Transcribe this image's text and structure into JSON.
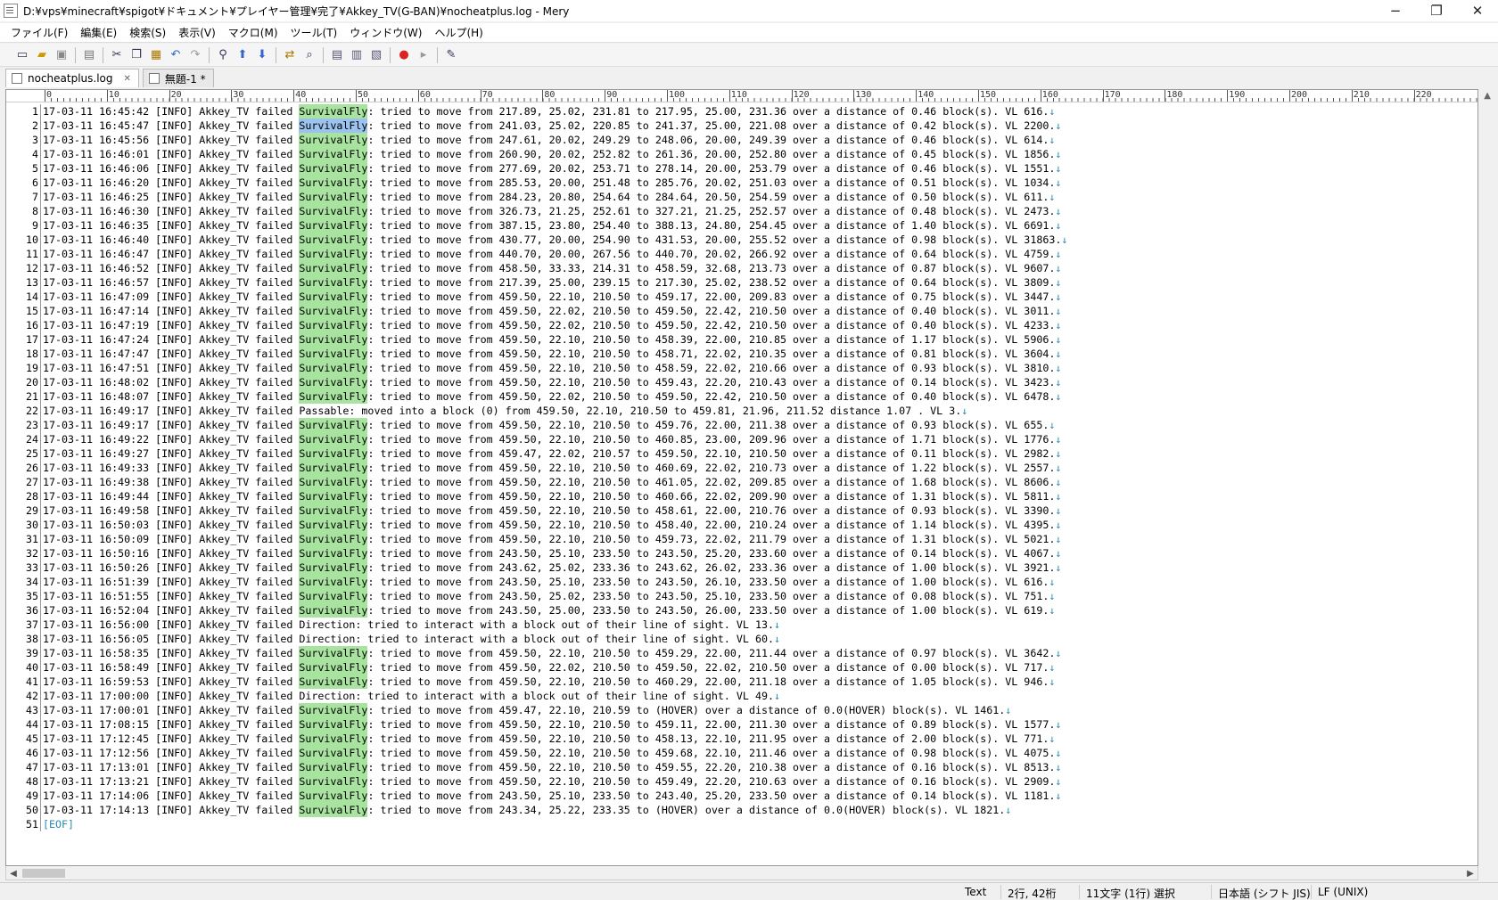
{
  "window": {
    "title": "D:¥vps¥minecraft¥spigot¥ドキュメント¥プレイヤー管理¥完了¥Akkey_TV(G-BAN)¥nocheatplus.log - Mery",
    "minimize": "−",
    "maximize": "❐",
    "close": "✕"
  },
  "menu": [
    "ファイル(F)",
    "編集(E)",
    "検索(S)",
    "表示(V)",
    "マクロ(M)",
    "ツール(T)",
    "ウィンドウ(W)",
    "ヘルプ(H)"
  ],
  "toolbar": [
    "new-file-icon",
    "open-file-icon",
    "save-icon",
    "print-icon",
    "cut-icon",
    "copy-icon",
    "paste-icon",
    "undo-icon",
    "redo-icon",
    "find-icon",
    "find-prev-icon",
    "find-next-icon",
    "replace-icon",
    "search-files-icon",
    "view-1-icon",
    "view-2-icon",
    "view-3-icon",
    "record-macro-icon",
    "play-macro-icon",
    "tools-icon"
  ],
  "tabs": [
    {
      "label": "nocheatplus.log",
      "close": "✕"
    },
    {
      "label": "無題-1 *"
    }
  ],
  "ruler": [
    "0",
    "10",
    "20",
    "30",
    "40",
    "50",
    "60",
    "70",
    "80",
    "90",
    "100",
    "110",
    "120",
    "130",
    "140",
    "150",
    "160",
    "170",
    "180",
    "190",
    "200",
    "210",
    "220"
  ],
  "lines": [
    {
      "n": "1",
      "pre": "17-03-11 16:45:42 [INFO] Akkey_TV failed ",
      "hl": "SurvivalFly",
      "post": ": tried to move from 217.89, 25.02, 231.81 to 217.95, 25.00, 231.36 over a distance of 0.46 block(s). VL 616."
    },
    {
      "n": "2",
      "pre": "17-03-11 16:45:47 [INFO] Akkey_TV failed ",
      "hl": "SurvivalFly",
      "post": ": tried to move from 241.03, 25.02, 220.85 to 241.37, 25.00, 221.08 over a distance of 0.42 block(s). VL 2200."
    },
    {
      "n": "3",
      "pre": "17-03-11 16:45:56 [INFO] Akkey_TV failed ",
      "hl": "SurvivalFly",
      "post": ": tried to move from 247.61, 20.02, 249.29 to 248.06, 20.00, 249.39 over a distance of 0.46 block(s). VL 614."
    },
    {
      "n": "4",
      "pre": "17-03-11 16:46:01 [INFO] Akkey_TV failed ",
      "hl": "SurvivalFly",
      "post": ": tried to move from 260.90, 20.02, 252.82 to 261.36, 20.00, 252.80 over a distance of 0.45 block(s). VL 1856."
    },
    {
      "n": "5",
      "pre": "17-03-11 16:46:06 [INFO] Akkey_TV failed ",
      "hl": "SurvivalFly",
      "post": ": tried to move from 277.69, 20.02, 253.71 to 278.14, 20.00, 253.79 over a distance of 0.46 block(s). VL 1551."
    },
    {
      "n": "6",
      "pre": "17-03-11 16:46:20 [INFO] Akkey_TV failed ",
      "hl": "SurvivalFly",
      "post": ": tried to move from 285.53, 20.00, 251.48 to 285.76, 20.02, 251.03 over a distance of 0.51 block(s). VL 1034."
    },
    {
      "n": "7",
      "pre": "17-03-11 16:46:25 [INFO] Akkey_TV failed ",
      "hl": "SurvivalFly",
      "post": ": tried to move from 284.23, 20.80, 254.64 to 284.64, 20.50, 254.59 over a distance of 0.50 block(s). VL 611."
    },
    {
      "n": "8",
      "pre": "17-03-11 16:46:30 [INFO] Akkey_TV failed ",
      "hl": "SurvivalFly",
      "post": ": tried to move from 326.73, 21.25, 252.61 to 327.21, 21.25, 252.57 over a distance of 0.48 block(s). VL 2473."
    },
    {
      "n": "9",
      "pre": "17-03-11 16:46:35 [INFO] Akkey_TV failed ",
      "hl": "SurvivalFly",
      "post": ": tried to move from 387.15, 23.80, 254.40 to 388.13, 24.80, 254.45 over a distance of 1.40 block(s). VL 6691."
    },
    {
      "n": "10",
      "pre": "17-03-11 16:46:40 [INFO] Akkey_TV failed ",
      "hl": "SurvivalFly",
      "post": ": tried to move from 430.77, 20.00, 254.90 to 431.53, 20.00, 255.52 over a distance of 0.98 block(s). VL 31863."
    },
    {
      "n": "11",
      "pre": "17-03-11 16:46:47 [INFO] Akkey_TV failed ",
      "hl": "SurvivalFly",
      "post": ": tried to move from 440.70, 20.00, 267.56 to 440.70, 20.02, 266.92 over a distance of 0.64 block(s). VL 4759."
    },
    {
      "n": "12",
      "pre": "17-03-11 16:46:52 [INFO] Akkey_TV failed ",
      "hl": "SurvivalFly",
      "post": ": tried to move from 458.50, 33.33, 214.31 to 458.59, 32.68, 213.73 over a distance of 0.87 block(s). VL 9607."
    },
    {
      "n": "13",
      "pre": "17-03-11 16:46:57 [INFO] Akkey_TV failed ",
      "hl": "SurvivalFly",
      "post": ": tried to move from 217.39, 25.00, 239.15 to 217.30, 25.02, 238.52 over a distance of 0.64 block(s). VL 3809."
    },
    {
      "n": "14",
      "pre": "17-03-11 16:47:09 [INFO] Akkey_TV failed ",
      "hl": "SurvivalFly",
      "post": ": tried to move from 459.50, 22.10, 210.50 to 459.17, 22.00, 209.83 over a distance of 0.75 block(s). VL 3447."
    },
    {
      "n": "15",
      "pre": "17-03-11 16:47:14 [INFO] Akkey_TV failed ",
      "hl": "SurvivalFly",
      "post": ": tried to move from 459.50, 22.02, 210.50 to 459.50, 22.42, 210.50 over a distance of 0.40 block(s). VL 3011."
    },
    {
      "n": "16",
      "pre": "17-03-11 16:47:19 [INFO] Akkey_TV failed ",
      "hl": "SurvivalFly",
      "post": ": tried to move from 459.50, 22.02, 210.50 to 459.50, 22.42, 210.50 over a distance of 0.40 block(s). VL 4233."
    },
    {
      "n": "17",
      "pre": "17-03-11 16:47:24 [INFO] Akkey_TV failed ",
      "hl": "SurvivalFly",
      "post": ": tried to move from 459.50, 22.10, 210.50 to 458.39, 22.00, 210.85 over a distance of 1.17 block(s). VL 5906."
    },
    {
      "n": "18",
      "pre": "17-03-11 16:47:47 [INFO] Akkey_TV failed ",
      "hl": "SurvivalFly",
      "post": ": tried to move from 459.50, 22.10, 210.50 to 458.71, 22.02, 210.35 over a distance of 0.81 block(s). VL 3604."
    },
    {
      "n": "19",
      "pre": "17-03-11 16:47:51 [INFO] Akkey_TV failed ",
      "hl": "SurvivalFly",
      "post": ": tried to move from 459.50, 22.10, 210.50 to 458.59, 22.02, 210.66 over a distance of 0.93 block(s). VL 3810."
    },
    {
      "n": "20",
      "pre": "17-03-11 16:48:02 [INFO] Akkey_TV failed ",
      "hl": "SurvivalFly",
      "post": ": tried to move from 459.50, 22.10, 210.50 to 459.43, 22.20, 210.43 over a distance of 0.14 block(s). VL 3423."
    },
    {
      "n": "21",
      "pre": "17-03-11 16:48:07 [INFO] Akkey_TV failed ",
      "hl": "SurvivalFly",
      "post": ": tried to move from 459.50, 22.02, 210.50 to 459.50, 22.42, 210.50 over a distance of 0.40 block(s). VL 6478."
    },
    {
      "n": "22",
      "pre": "17-03-11 16:49:17 [INFO] Akkey_TV failed Passable: moved into a block (0) from 459.50, 22.10, 210.50 to 459.81, 21.96, 211.52 distance 1.07 . VL 3.",
      "hl": "",
      "post": ""
    },
    {
      "n": "23",
      "pre": "17-03-11 16:49:17 [INFO] Akkey_TV failed ",
      "hl": "SurvivalFly",
      "post": ": tried to move from 459.50, 22.10, 210.50 to 459.76, 22.00, 211.38 over a distance of 0.93 block(s). VL 655."
    },
    {
      "n": "24",
      "pre": "17-03-11 16:49:22 [INFO] Akkey_TV failed ",
      "hl": "SurvivalFly",
      "post": ": tried to move from 459.50, 22.10, 210.50 to 460.85, 23.00, 209.96 over a distance of 1.71 block(s). VL 1776."
    },
    {
      "n": "25",
      "pre": "17-03-11 16:49:27 [INFO] Akkey_TV failed ",
      "hl": "SurvivalFly",
      "post": ": tried to move from 459.47, 22.02, 210.57 to 459.50, 22.10, 210.50 over a distance of 0.11 block(s). VL 2982."
    },
    {
      "n": "26",
      "pre": "17-03-11 16:49:33 [INFO] Akkey_TV failed ",
      "hl": "SurvivalFly",
      "post": ": tried to move from 459.50, 22.10, 210.50 to 460.69, 22.02, 210.73 over a distance of 1.22 block(s). VL 2557."
    },
    {
      "n": "27",
      "pre": "17-03-11 16:49:38 [INFO] Akkey_TV failed ",
      "hl": "SurvivalFly",
      "post": ": tried to move from 459.50, 22.10, 210.50 to 461.05, 22.02, 209.85 over a distance of 1.68 block(s). VL 8606."
    },
    {
      "n": "28",
      "pre": "17-03-11 16:49:44 [INFO] Akkey_TV failed ",
      "hl": "SurvivalFly",
      "post": ": tried to move from 459.50, 22.10, 210.50 to 460.66, 22.02, 209.90 over a distance of 1.31 block(s). VL 5811."
    },
    {
      "n": "29",
      "pre": "17-03-11 16:49:58 [INFO] Akkey_TV failed ",
      "hl": "SurvivalFly",
      "post": ": tried to move from 459.50, 22.10, 210.50 to 458.61, 22.00, 210.76 over a distance of 0.93 block(s). VL 3390."
    },
    {
      "n": "30",
      "pre": "17-03-11 16:50:03 [INFO] Akkey_TV failed ",
      "hl": "SurvivalFly",
      "post": ": tried to move from 459.50, 22.10, 210.50 to 458.40, 22.00, 210.24 over a distance of 1.14 block(s). VL 4395."
    },
    {
      "n": "31",
      "pre": "17-03-11 16:50:09 [INFO] Akkey_TV failed ",
      "hl": "SurvivalFly",
      "post": ": tried to move from 459.50, 22.10, 210.50 to 459.73, 22.02, 211.79 over a distance of 1.31 block(s). VL 5021."
    },
    {
      "n": "32",
      "pre": "17-03-11 16:50:16 [INFO] Akkey_TV failed ",
      "hl": "SurvivalFly",
      "post": ": tried to move from 243.50, 25.10, 233.50 to 243.50, 25.20, 233.60 over a distance of 0.14 block(s). VL 4067."
    },
    {
      "n": "33",
      "pre": "17-03-11 16:50:26 [INFO] Akkey_TV failed ",
      "hl": "SurvivalFly",
      "post": ": tried to move from 243.62, 25.02, 233.36 to 243.62, 26.02, 233.36 over a distance of 1.00 block(s). VL 3921."
    },
    {
      "n": "34",
      "pre": "17-03-11 16:51:39 [INFO] Akkey_TV failed ",
      "hl": "SurvivalFly",
      "post": ": tried to move from 243.50, 25.10, 233.50 to 243.50, 26.10, 233.50 over a distance of 1.00 block(s). VL 616."
    },
    {
      "n": "35",
      "pre": "17-03-11 16:51:55 [INFO] Akkey_TV failed ",
      "hl": "SurvivalFly",
      "post": ": tried to move from 243.50, 25.02, 233.50 to 243.50, 25.10, 233.50 over a distance of 0.08 block(s). VL 751."
    },
    {
      "n": "36",
      "pre": "17-03-11 16:52:04 [INFO] Akkey_TV failed ",
      "hl": "SurvivalFly",
      "post": ": tried to move from 243.50, 25.00, 233.50 to 243.50, 26.00, 233.50 over a distance of 1.00 block(s). VL 619."
    },
    {
      "n": "37",
      "pre": "17-03-11 16:56:00 [INFO] Akkey_TV failed Direction: tried to interact with a block out of their line of sight. VL 13.",
      "hl": "",
      "post": ""
    },
    {
      "n": "38",
      "pre": "17-03-11 16:56:05 [INFO] Akkey_TV failed Direction: tried to interact with a block out of their line of sight. VL 60.",
      "hl": "",
      "post": ""
    },
    {
      "n": "39",
      "pre": "17-03-11 16:58:35 [INFO] Akkey_TV failed ",
      "hl": "SurvivalFly",
      "post": ": tried to move from 459.50, 22.10, 210.50 to 459.29, 22.00, 211.44 over a distance of 0.97 block(s). VL 3642."
    },
    {
      "n": "40",
      "pre": "17-03-11 16:58:49 [INFO] Akkey_TV failed ",
      "hl": "SurvivalFly",
      "post": ": tried to move from 459.50, 22.02, 210.50 to 459.50, 22.02, 210.50 over a distance of 0.00 block(s). VL 717."
    },
    {
      "n": "41",
      "pre": "17-03-11 16:59:53 [INFO] Akkey_TV failed ",
      "hl": "SurvivalFly",
      "post": ": tried to move from 459.50, 22.10, 210.50 to 460.29, 22.00, 211.18 over a distance of 1.05 block(s). VL 946."
    },
    {
      "n": "42",
      "pre": "17-03-11 17:00:00 [INFO] Akkey_TV failed Direction: tried to interact with a block out of their line of sight. VL 49.",
      "hl": "",
      "post": ""
    },
    {
      "n": "43",
      "pre": "17-03-11 17:00:01 [INFO] Akkey_TV failed ",
      "hl": "SurvivalFly",
      "post": ": tried to move from 459.47, 22.10, 210.59 to (HOVER) over a distance of 0.0(HOVER) block(s). VL 1461."
    },
    {
      "n": "44",
      "pre": "17-03-11 17:08:15 [INFO] Akkey_TV failed ",
      "hl": "SurvivalFly",
      "post": ": tried to move from 459.50, 22.10, 210.50 to 459.11, 22.00, 211.30 over a distance of 0.89 block(s). VL 1577."
    },
    {
      "n": "45",
      "pre": "17-03-11 17:12:45 [INFO] Akkey_TV failed ",
      "hl": "SurvivalFly",
      "post": ": tried to move from 459.50, 22.10, 210.50 to 458.13, 22.10, 211.95 over a distance of 2.00 block(s). VL 771."
    },
    {
      "n": "46",
      "pre": "17-03-11 17:12:56 [INFO] Akkey_TV failed ",
      "hl": "SurvivalFly",
      "post": ": tried to move from 459.50, 22.10, 210.50 to 459.68, 22.10, 211.46 over a distance of 0.98 block(s). VL 4075."
    },
    {
      "n": "47",
      "pre": "17-03-11 17:13:01 [INFO] Akkey_TV failed ",
      "hl": "SurvivalFly",
      "post": ": tried to move from 459.50, 22.10, 210.50 to 459.55, 22.20, 210.38 over a distance of 0.16 block(s). VL 8513."
    },
    {
      "n": "48",
      "pre": "17-03-11 17:13:21 [INFO] Akkey_TV failed ",
      "hl": "SurvivalFly",
      "post": ": tried to move from 459.50, 22.10, 210.50 to 459.49, 22.20, 210.63 over a distance of 0.16 block(s). VL 2909."
    },
    {
      "n": "49",
      "pre": "17-03-11 17:14:06 [INFO] Akkey_TV failed ",
      "hl": "SurvivalFly",
      "post": ": tried to move from 243.50, 25.10, 233.50 to 243.40, 25.20, 233.50 over a distance of 0.14 block(s). VL 1181."
    },
    {
      "n": "50",
      "pre": "17-03-11 17:14:13 [INFO] Akkey_TV failed ",
      "hl": "SurvivalFly",
      "post": ": tried to move from 243.34, 25.22, 233.35 to (HOVER) over a distance of 0.0(HOVER) block(s). VL 1821."
    },
    {
      "n": "51",
      "eof": "[EOF]"
    }
  ],
  "eol_mark": "↓",
  "status": {
    "mode": "Text",
    "position": "2行, 42桁",
    "selection": "11文字 (1行) 選択",
    "encoding": "日本語 (シフト JIS)",
    "line_ending": "LF (UNIX)"
  },
  "colors": {
    "highlight": "#a8e4a0",
    "selection": "#9cc3f0",
    "eol": "#2a8ab0"
  }
}
